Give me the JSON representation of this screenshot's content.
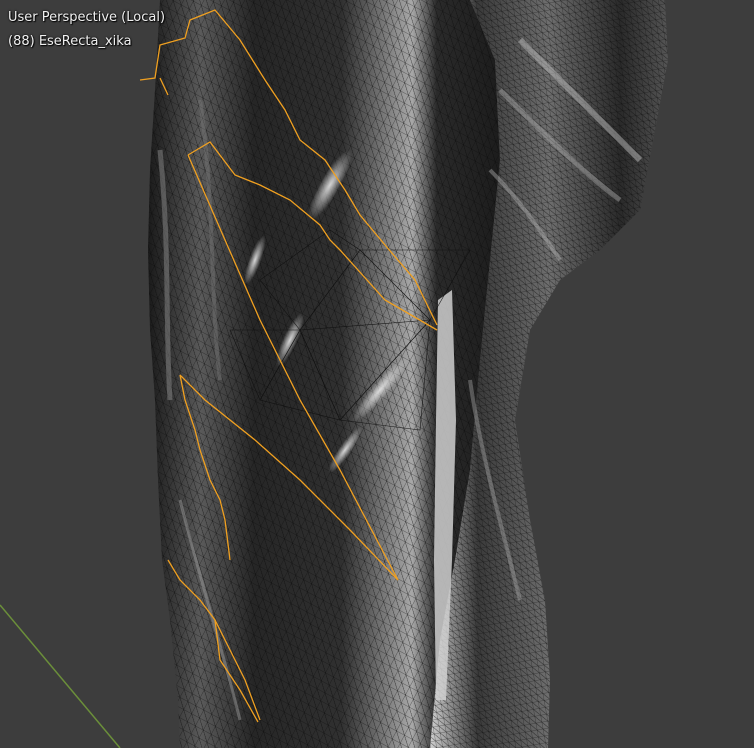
{
  "viewport": {
    "view_name": "User Perspective (Local)",
    "object_info": "(88) EseRecta_xika"
  },
  "colors": {
    "background": "#3d3d3d",
    "mesh_dark": "#202020",
    "mesh_mid": "#2c2c2c",
    "mesh_light": "#9a9a9a",
    "wire": "#0c0c0c",
    "selection": "#f0a020",
    "grid_axis": "#6b8f3a"
  },
  "icons": [
    "mesh-object",
    "selected-edges",
    "grid-axis-line"
  ]
}
